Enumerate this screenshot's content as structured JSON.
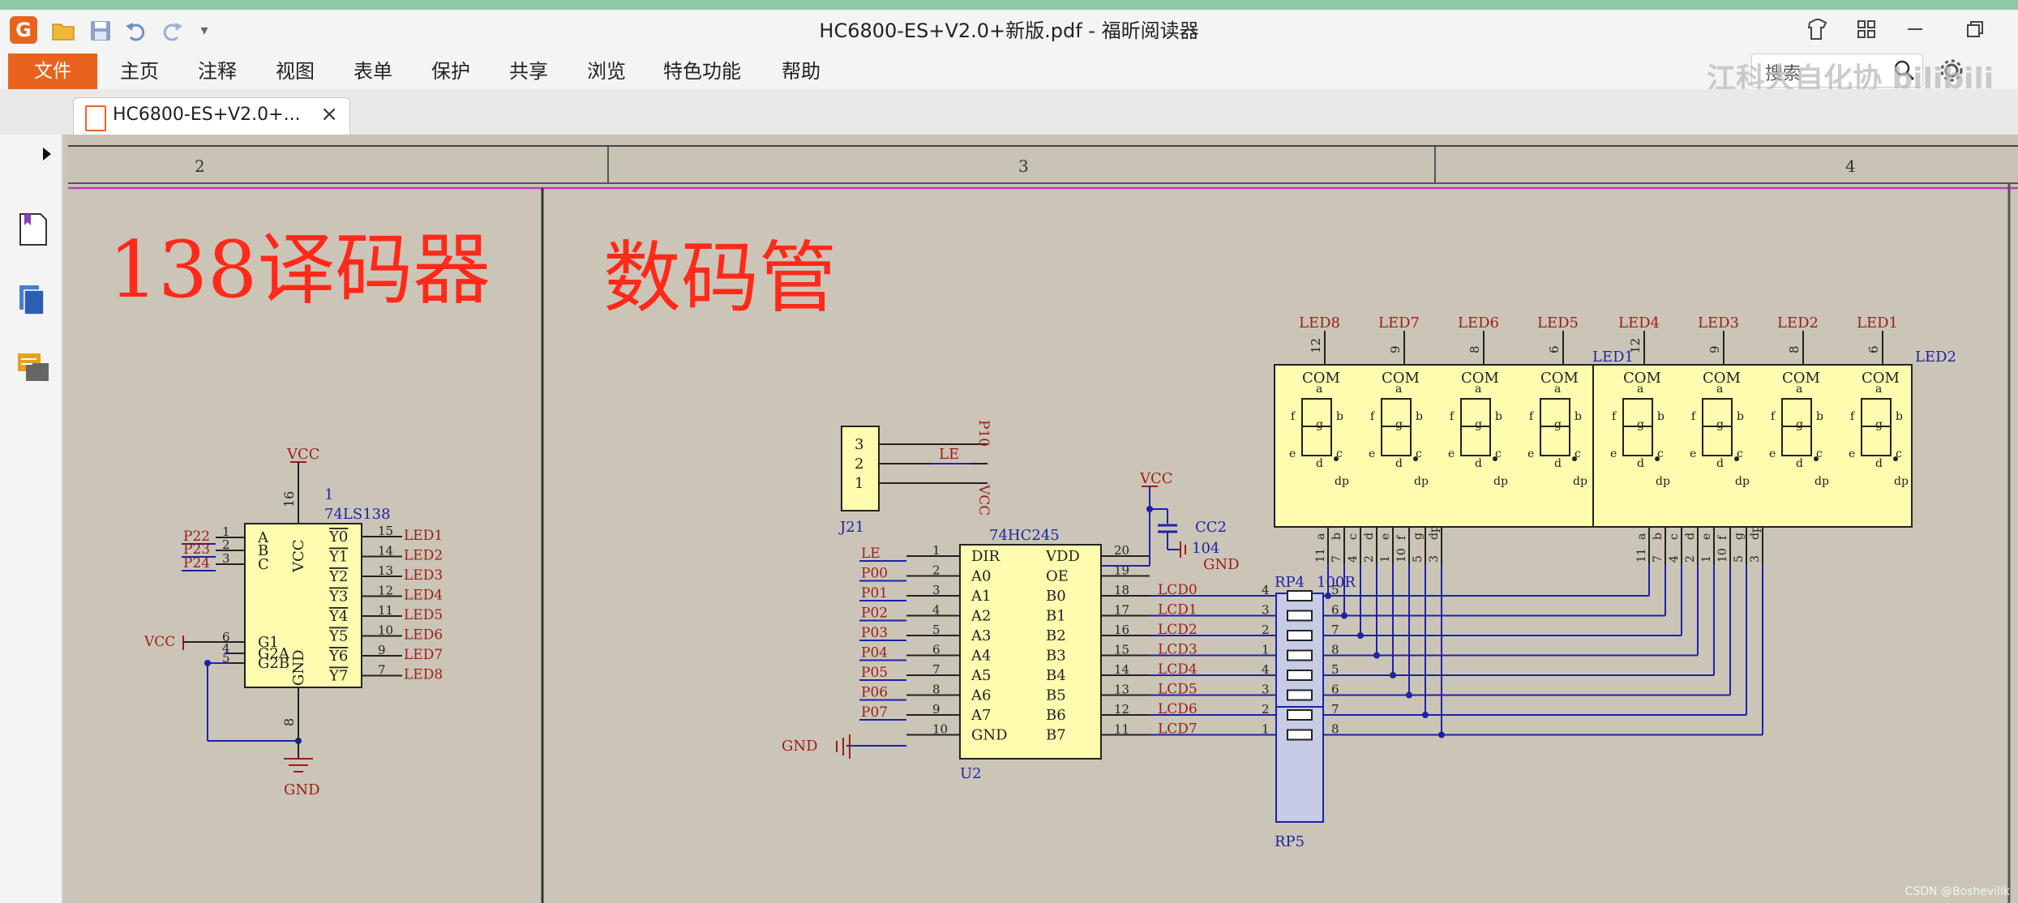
{
  "window": {
    "title": "HC6800-ES+V2.0+新版.pdf - 福昕阅读器"
  },
  "menu": {
    "file": "文件",
    "items": [
      "主页",
      "注释",
      "视图",
      "表单",
      "保护",
      "共享",
      "浏览",
      "特色功能",
      "帮助"
    ]
  },
  "search": {
    "text": "搜索",
    "watermark": "江科大自化协 bilibili"
  },
  "tab": {
    "label": "HC6800-ES+V2.0+...",
    "close": "×"
  },
  "colors": {
    "accent": "#e8641e",
    "schematic_bg": "#cbc5b8",
    "chip_fill": "#fffcb0",
    "net_red": "#9b1d16",
    "wire_blue": "#1c22a8",
    "title_red": "#ff2a1a",
    "border_magenta": "#c03bc0"
  },
  "icons": {
    "logo": "foxit-logo",
    "open": "folder-open-icon",
    "save": "save-icon",
    "undo": "undo-icon",
    "redo": "redo-icon",
    "customize": "dropdown-icon",
    "skin": "shirt-icon",
    "layout": "grid-icon",
    "minimize": "minimize-icon",
    "restore": "restore-icon",
    "search": "search-icon",
    "settings": "gear-icon",
    "sidebar_toggle": "triangle-right-icon",
    "bookmark": "bookmark-icon",
    "pages": "pages-icon",
    "comments": "comments-icon"
  },
  "schematic": {
    "ruler": {
      "col2": "2",
      "col3": "3",
      "col4": "4"
    },
    "title_decoder": "138译码器",
    "title_display": "数码管",
    "decoder": {
      "vcc": "VCC",
      "gnd": "GND",
      "pin16": "16",
      "pin8": "8",
      "designator": "1",
      "part": "74LS138",
      "p22": "P22",
      "p23": "P23",
      "p24": "P24",
      "in_pins": [
        "1",
        "2",
        "3"
      ],
      "in_labels": [
        "A",
        "B",
        "C"
      ],
      "chip_vcc": "VCC",
      "chip_gnd": "GND",
      "g_vcc": "VCC",
      "g_pins": [
        "6",
        "4",
        "5"
      ],
      "g_labels": [
        "G1",
        "G2A",
        "G2B"
      ],
      "out_labels": [
        "Y0",
        "Y1",
        "Y2",
        "Y3",
        "Y4",
        "Y5",
        "Y6",
        "Y7"
      ],
      "out_pins": [
        "15",
        "14",
        "13",
        "12",
        "11",
        "10",
        "9",
        "7"
      ],
      "led_nets": [
        "LED1",
        "LED2",
        "LED3",
        "LED4",
        "LED5",
        "LED6",
        "LED7",
        "LED8"
      ]
    },
    "j21": {
      "name": "J21",
      "pins": [
        "3",
        "2",
        "1"
      ],
      "nets": [
        "P10",
        "LE",
        "VCC"
      ]
    },
    "u2": {
      "part": "74HC245",
      "name": "U2",
      "left_nets": [
        "LE",
        "P00",
        "P01",
        "P02",
        "P03",
        "P04",
        "P05",
        "P06",
        "P07"
      ],
      "left_pins": [
        "1",
        "2",
        "3",
        "4",
        "5",
        "6",
        "7",
        "8",
        "9",
        "10"
      ],
      "left_labels": [
        "DIR",
        "A0",
        "A1",
        "A2",
        "A3",
        "A4",
        "A5",
        "A6",
        "A7",
        "GND"
      ],
      "right_labels": [
        "VDD",
        "OE",
        "B0",
        "B1",
        "B2",
        "B3",
        "B4",
        "B5",
        "B6",
        "B7"
      ],
      "right_pins": [
        "20",
        "19",
        "18",
        "17",
        "16",
        "15",
        "14",
        "13",
        "12",
        "11"
      ],
      "lcd_nets": [
        "LCD0",
        "LCD1",
        "LCD2",
        "LCD3",
        "LCD4",
        "LCD5",
        "LCD6",
        "LCD7"
      ],
      "gnd": "GND"
    },
    "cap": {
      "vcc": "VCC",
      "name": "CC2",
      "value": "104",
      "gnd": "GND"
    },
    "resistors": {
      "rp4": "RP4",
      "rp5": "RP5",
      "value": "100R",
      "left_pins": [
        "4",
        "3",
        "2",
        "1",
        "4",
        "3",
        "2",
        "1"
      ],
      "right_pins": [
        "5",
        "6",
        "7",
        "8",
        "5",
        "6",
        "7",
        "8"
      ]
    },
    "display": {
      "led_top": [
        "LED8",
        "LED7",
        "LED6",
        "LED5",
        "LED4",
        "LED3",
        "LED2",
        "LED1"
      ],
      "com_pins": [
        "12",
        "9",
        "8",
        "6",
        "12",
        "9",
        "8",
        "6"
      ],
      "com": "COM",
      "module_labels": [
        "LED1",
        "LED2"
      ],
      "seg_letters": [
        "a",
        "b",
        "c",
        "d",
        "e",
        "f",
        "g",
        "dp"
      ],
      "bottom_letters": [
        "a",
        "b",
        "c",
        "d",
        "e",
        "f",
        "g",
        "dp"
      ],
      "bottom_pins": [
        "11",
        "7",
        "4",
        "2",
        "1",
        "10",
        "5",
        "3"
      ]
    }
  }
}
